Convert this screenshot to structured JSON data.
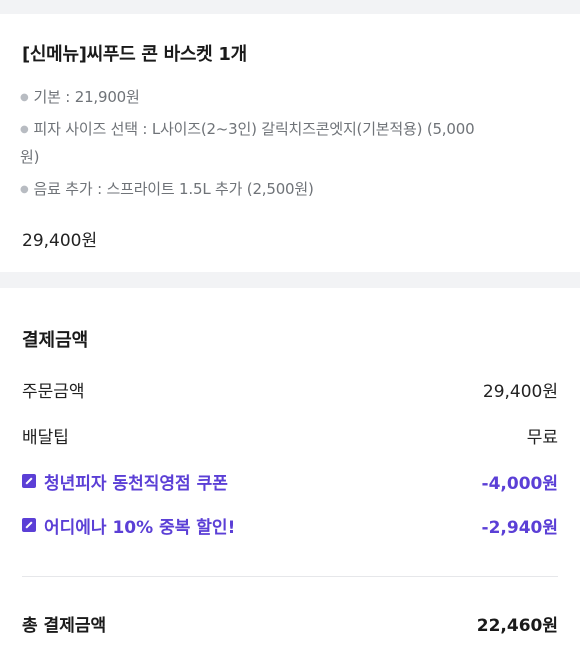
{
  "order_item": {
    "title": "[신메뉴]씨푸드 콘 바스켓 1개",
    "options": [
      "기본 : 21,900원",
      "피자 사이즈 선택 : L사이즈(2~3인) 갈릭치즈콘엣지(기본적용) (5,000",
      "원)",
      "음료 추가 : 스프라이트 1.5L 추가 (2,500원)"
    ],
    "price": "29,400원"
  },
  "payment": {
    "title": "결제금액",
    "order_amount_label": "주문금액",
    "order_amount_value": "29,400원",
    "delivery_tip_label": "배달팁",
    "delivery_tip_value": "무료",
    "discounts": [
      {
        "label": "청년피자 동천직영점 쿠폰",
        "value": "-4,000원"
      },
      {
        "label": "어디에나 10% 중복 할인!",
        "value": "-2,940원"
      }
    ],
    "total_label": "총 결제금액",
    "total_value": "22,460원"
  },
  "colors": {
    "accent": "#5b3fd6",
    "background": "#f2f3f5"
  }
}
